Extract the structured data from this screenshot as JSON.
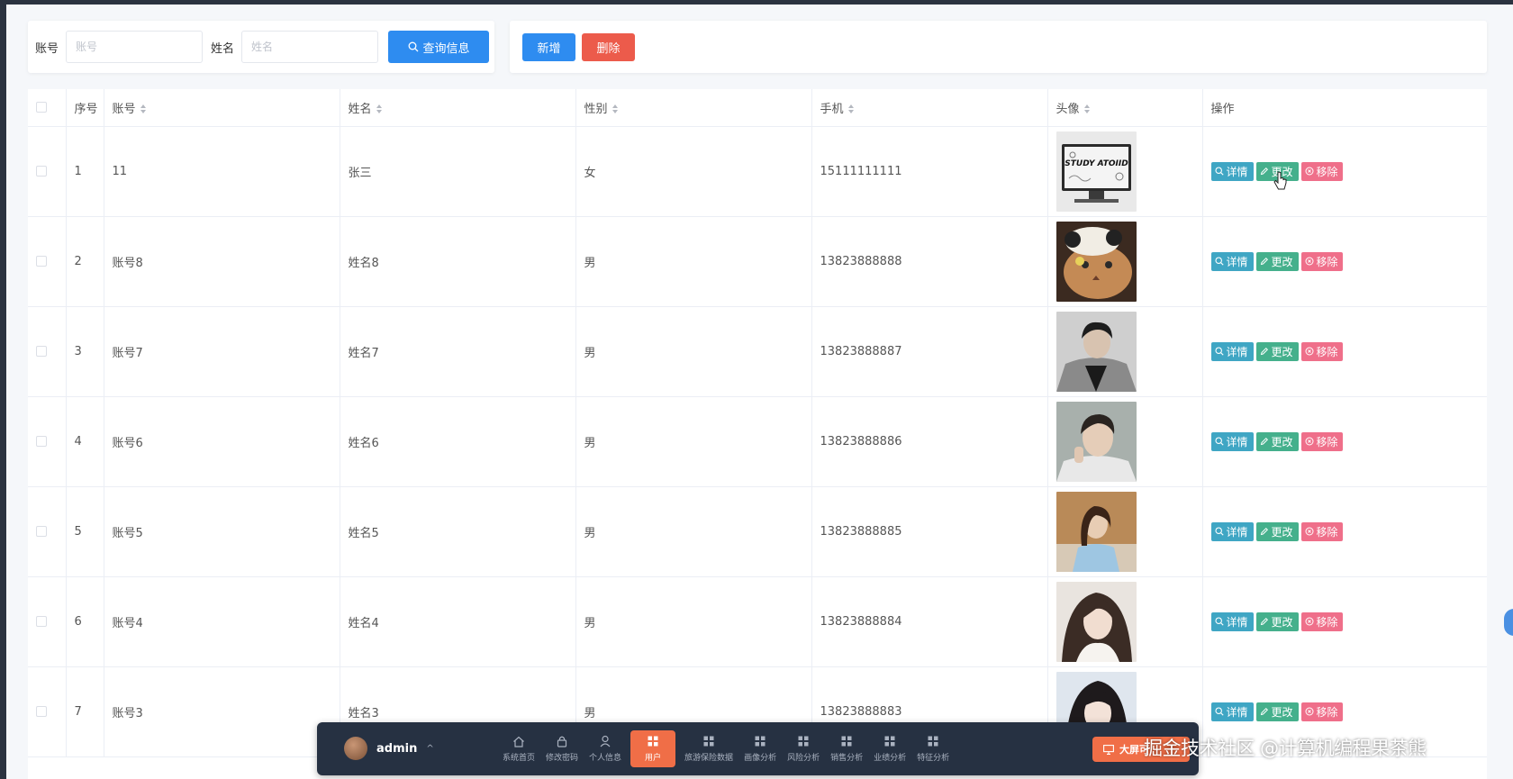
{
  "search": {
    "account_label": "账号",
    "account_placeholder": "账号",
    "name_label": "姓名",
    "name_placeholder": "姓名",
    "query_button": "查询信息"
  },
  "actions": {
    "add_button": "新增",
    "delete_button": "删除"
  },
  "table": {
    "headers": {
      "index": "序号",
      "account": "账号",
      "name": "姓名",
      "gender": "性别",
      "phone": "手机",
      "avatar": "头像",
      "operation": "操作"
    },
    "rows": [
      {
        "index": "1",
        "account": "11",
        "name": "张三",
        "gender": "女",
        "phone": "15111111111",
        "avatar_text": "STUDY ATOIID"
      },
      {
        "index": "2",
        "account": "账号8",
        "name": "姓名8",
        "gender": "男",
        "phone": "13823888888"
      },
      {
        "index": "3",
        "account": "账号7",
        "name": "姓名7",
        "gender": "男",
        "phone": "13823888887"
      },
      {
        "index": "4",
        "account": "账号6",
        "name": "姓名6",
        "gender": "男",
        "phone": "13823888886"
      },
      {
        "index": "5",
        "account": "账号5",
        "name": "姓名5",
        "gender": "男",
        "phone": "13823888885"
      },
      {
        "index": "6",
        "account": "账号4",
        "name": "姓名4",
        "gender": "男",
        "phone": "13823888884"
      },
      {
        "index": "7",
        "account": "账号3",
        "name": "姓名3",
        "gender": "男",
        "phone": "13823888883"
      }
    ],
    "op_labels": {
      "detail": "详情",
      "edit": "更改",
      "remove": "移除"
    }
  },
  "dock": {
    "username": "admin",
    "nav": [
      {
        "label": "系统首页",
        "icon": "home-icon"
      },
      {
        "label": "修改密码",
        "icon": "lock-icon"
      },
      {
        "label": "个人信息",
        "icon": "user-icon"
      },
      {
        "label": "用户",
        "icon": "grid-icon",
        "active": true
      },
      {
        "label": "旅游保险数据",
        "icon": "grid-icon"
      },
      {
        "label": "画像分析",
        "icon": "grid-icon"
      },
      {
        "label": "风险分析",
        "icon": "grid-icon"
      },
      {
        "label": "销售分析",
        "icon": "grid-icon"
      },
      {
        "label": "业绩分析",
        "icon": "grid-icon"
      },
      {
        "label": "特征分析",
        "icon": "grid-icon"
      }
    ],
    "big_screen_label": "大屏可"
  },
  "watermark": "掘金技术社区 @计算机编程果茶熊",
  "colors": {
    "primary": "#2e8cf0",
    "danger": "#ec5b4b",
    "detail": "#3fa6c4",
    "edit": "#45b08c",
    "remove": "#ef6f8a",
    "dock_bg": "#263142",
    "dock_active": "#f06e47"
  }
}
